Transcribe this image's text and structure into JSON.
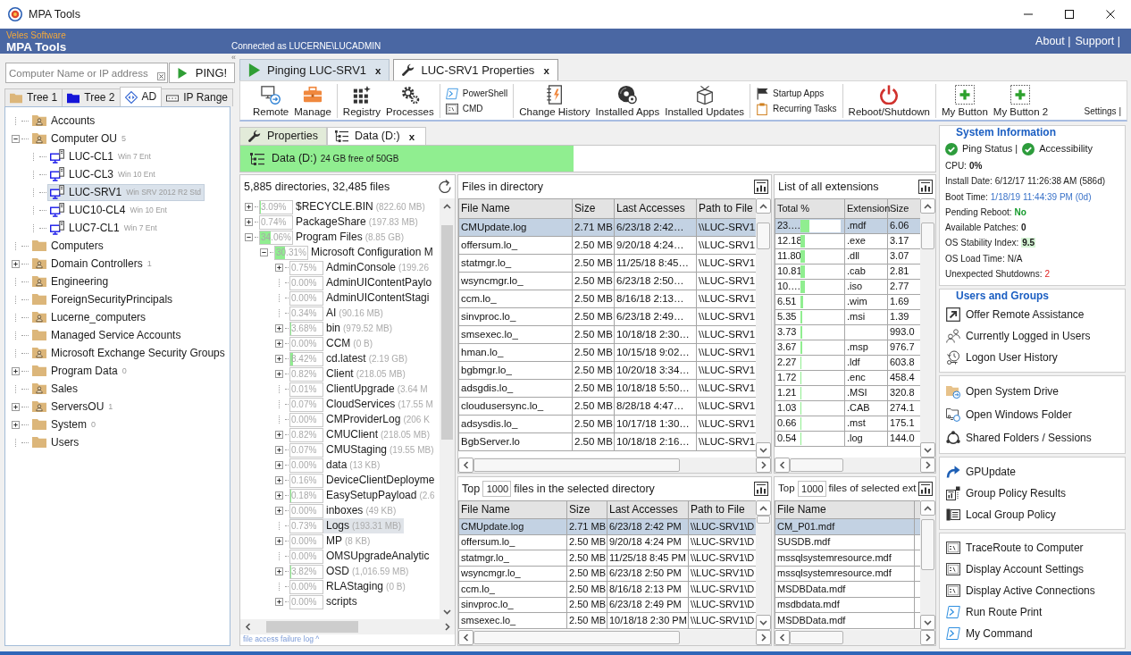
{
  "window": {
    "title": "MPA Tools"
  },
  "header": {
    "vendor": "Veles Software",
    "product": "MPA Tools",
    "connection": "Connected as LUCERNE\\LUCADMIN",
    "links": [
      "About |",
      "Support |"
    ]
  },
  "left_panel": {
    "collapse": "«",
    "ping": {
      "placeholder": "Computer Name or IP address",
      "button": "PING!"
    },
    "tabs": [
      {
        "label": "Tree 1",
        "selected": false
      },
      {
        "label": "Tree 2",
        "selected": false
      },
      {
        "label": "AD",
        "selected": true
      },
      {
        "label": "IP Range",
        "selected": false
      }
    ],
    "tree": [
      {
        "label": "Accounts",
        "kind": "ou",
        "expandable": false,
        "selected": false
      },
      {
        "label": "Computer OU",
        "kind": "ou",
        "count": "5",
        "expandable": true,
        "expanded": true,
        "selected": false,
        "children": [
          {
            "label": "LUC-CL1",
            "kind": "computer",
            "os": "Win 7 Ent",
            "expandable": false,
            "selected": false
          },
          {
            "label": "LUC-CL3",
            "kind": "computer",
            "os": "Win 10 Ent",
            "expandable": false,
            "selected": false
          },
          {
            "label": "LUC-SRV1",
            "kind": "computer",
            "os": "Win SRV 2012 R2 Std",
            "expandable": false,
            "selected": true
          },
          {
            "label": "LUC10-CL4",
            "kind": "computer",
            "os": "Win 10 Ent",
            "expandable": false,
            "selected": false
          },
          {
            "label": "LUC7-CL1",
            "kind": "computer",
            "os": "Win 7 Ent",
            "expandable": false,
            "selected": false
          }
        ]
      },
      {
        "label": "Computers",
        "kind": "folder",
        "expandable": false,
        "selected": false
      },
      {
        "label": "Domain Controllers",
        "kind": "ou",
        "count": "1",
        "expandable": true,
        "expanded": false,
        "selected": false
      },
      {
        "label": "Engineering",
        "kind": "ou",
        "expandable": false,
        "selected": false
      },
      {
        "label": "ForeignSecurityPrincipals",
        "kind": "folder",
        "expandable": false,
        "selected": false
      },
      {
        "label": "Lucerne_computers",
        "kind": "ou",
        "expandable": false,
        "selected": false
      },
      {
        "label": "Managed Service Accounts",
        "kind": "folder",
        "expandable": false,
        "selected": false
      },
      {
        "label": "Microsoft Exchange Security Groups",
        "kind": "ou",
        "expandable": false,
        "selected": false
      },
      {
        "label": "Program Data",
        "kind": "folder",
        "count": "0",
        "expandable": true,
        "expanded": false,
        "selected": false
      },
      {
        "label": "Sales",
        "kind": "ou",
        "expandable": false,
        "selected": false
      },
      {
        "label": "ServersOU",
        "kind": "ou",
        "count": "1",
        "expandable": true,
        "expanded": false,
        "selected": false
      },
      {
        "label": "System",
        "kind": "folder",
        "count": "0",
        "expandable": true,
        "expanded": false,
        "selected": false
      },
      {
        "label": "Users",
        "kind": "folder",
        "expandable": false,
        "selected": false
      }
    ]
  },
  "tabs": [
    {
      "label": "Pinging LUC-SRV1",
      "close": "x",
      "selected": false
    },
    {
      "label": "LUC-SRV1 Properties",
      "close": "x",
      "selected": true
    }
  ],
  "toolbar": {
    "groups": [
      {
        "items": [
          {
            "label": "Remote",
            "kind": "large"
          },
          {
            "label": "Manage",
            "kind": "large"
          }
        ]
      },
      {
        "items": [
          {
            "label": "Registry",
            "kind": "large"
          },
          {
            "label": "Processes",
            "kind": "large"
          }
        ]
      },
      {
        "items": [
          {
            "label": "PowerShell",
            "kind": "small"
          },
          {
            "label": "CMD",
            "kind": "small"
          }
        ]
      },
      {
        "items": [
          {
            "label": "Change History",
            "kind": "large"
          },
          {
            "label": "Installed Apps",
            "kind": "large"
          },
          {
            "label": "Installed Updates",
            "kind": "large"
          }
        ]
      },
      {
        "items": [
          {
            "label": "Startup Apps",
            "kind": "small"
          },
          {
            "label": "Recurring Tasks",
            "kind": "small"
          }
        ]
      },
      {
        "items": [
          {
            "label": "Reboot/Shutdown",
            "kind": "large"
          }
        ]
      },
      {
        "items": [
          {
            "label": "My Button",
            "kind": "large"
          },
          {
            "label": "My Button 2",
            "kind": "large"
          }
        ]
      }
    ],
    "settings": "Settings |"
  },
  "sub_tabs": [
    {
      "label": "Properties",
      "selected": false
    },
    {
      "label": "Data (D:)",
      "close": "x",
      "selected": true
    }
  ],
  "drive": {
    "label": "Data (D:)",
    "detail": "24 GB free of 50GB",
    "level": 0.48
  },
  "directory": {
    "summary": "5,885 directories, 32,485 files",
    "items": [
      {
        "name": "$RECYCLE.BIN",
        "size": "(822.60 MB)",
        "percent": "3.09%",
        "level": 0.04,
        "expandable": true,
        "expanded": false,
        "selected": false
      },
      {
        "name": "PackageShare",
        "size": "(197.83 MB)",
        "percent": "0.74%",
        "expandable": true,
        "expanded": false,
        "selected": false
      },
      {
        "name": "Program Files",
        "size": "(8.85 GB)",
        "percent": "34.06%",
        "level": 0.34,
        "expandable": true,
        "expanded": true,
        "selected": false,
        "children": [
          {
            "name": "Microsoft Configuration M",
            "percent": "30.31%",
            "level": 0.3,
            "expandable": true,
            "expanded": true,
            "selected": false,
            "children": [
              {
                "name": "AdminConsole",
                "size": "(199.26",
                "percent": "0.75%",
                "expandable": true,
                "expanded": false,
                "selected": false
              },
              {
                "name": "AdminUIContentPaylo",
                "percent": "0.00%",
                "expandable": false,
                "selected": false
              },
              {
                "name": "AdminUIContentStagi",
                "percent": "0.00%",
                "expandable": false,
                "selected": false
              },
              {
                "name": "AI",
                "size": "(90.16 MB)",
                "percent": "0.34%",
                "expandable": false,
                "selected": false
              },
              {
                "name": "bin",
                "size": "(979.52 MB)",
                "percent": "3.68%",
                "level": 0.04,
                "expandable": true,
                "expanded": false,
                "selected": false
              },
              {
                "name": "CCM",
                "size": "(0 B)",
                "percent": "0.00%",
                "expandable": true,
                "expanded": false,
                "selected": false
              },
              {
                "name": "cd.latest",
                "size": "(2.19 GB)",
                "percent": "8.42%",
                "level": 0.08,
                "expandable": true,
                "expanded": false,
                "selected": false
              },
              {
                "name": "Client",
                "size": "(218.05 MB)",
                "percent": "0.82%",
                "expandable": true,
                "expanded": false,
                "selected": false
              },
              {
                "name": "ClientUpgrade",
                "size": "(3.64 M",
                "percent": "0.01%",
                "expandable": false,
                "selected": false
              },
              {
                "name": "CloudServices",
                "size": "(17.55 M",
                "percent": "0.07%",
                "expandable": false,
                "selected": false
              },
              {
                "name": "CMProviderLog",
                "size": "(206 K",
                "percent": "0.00%",
                "expandable": false,
                "selected": false
              },
              {
                "name": "CMUClient",
                "size": "(218.05 MB)",
                "percent": "0.82%",
                "expandable": true,
                "expanded": false,
                "selected": false
              },
              {
                "name": "CMUStaging",
                "size": "(19.55 MB)",
                "percent": "0.07%",
                "expandable": true,
                "expanded": false,
                "selected": false
              },
              {
                "name": "data",
                "size": "(13 KB)",
                "percent": "0.00%",
                "expandable": true,
                "expanded": false,
                "selected": false
              },
              {
                "name": "DeviceClientDeployme",
                "percent": "0.16%",
                "expandable": true,
                "expanded": false,
                "selected": false
              },
              {
                "name": "EasySetupPayload",
                "size": "(2.6",
                "percent": "0.18%",
                "level": 0.03,
                "expandable": true,
                "expanded": false,
                "selected": false
              },
              {
                "name": "inboxes",
                "size": "(49 KB)",
                "percent": "0.00%",
                "expandable": true,
                "expanded": false,
                "selected": false
              },
              {
                "name": "Logs",
                "size": "(193.31 MB)",
                "percent": "0.73%",
                "expandable": false,
                "selected": true
              },
              {
                "name": "MP",
                "size": "(8 KB)",
                "percent": "0.00%",
                "expandable": true,
                "expanded": false,
                "selected": false
              },
              {
                "name": "OMSUpgradeAnalytic",
                "percent": "0.00%",
                "expandable": false,
                "selected": false
              },
              {
                "name": "OSD",
                "size": "(1,016.59 MB)",
                "percent": "3.82%",
                "level": 0.04,
                "expandable": true,
                "expanded": false,
                "selected": false
              },
              {
                "name": "RLAStaging",
                "size": "(0 B)",
                "percent": "0.00%",
                "expandable": false,
                "selected": false
              },
              {
                "name": "scripts",
                "percent": "0.00%",
                "expandable": true,
                "expanded": false,
                "selected": false
              }
            ]
          }
        ]
      }
    ],
    "footer": "file access failure log ^"
  },
  "files": {
    "title": "Files in directory",
    "columns": [
      "File Name",
      "Size",
      "Last Accesses",
      "Path to File"
    ],
    "rows": [
      {
        "cells": [
          "CMUpdate.log",
          "2.71 MB",
          "6/23/18 2:42…",
          "\\\\LUC-SRV1"
        ],
        "selected": true
      },
      {
        "cells": [
          "offersum.lo_",
          "2.50 MB",
          "9/20/18 4:24…",
          "\\\\LUC-SRV1"
        ],
        "selected": false
      },
      {
        "cells": [
          "statmgr.lo_",
          "2.50 MB",
          "11/25/18 8:45…",
          "\\\\LUC-SRV1"
        ],
        "selected": false
      },
      {
        "cells": [
          "wsyncmgr.lo_",
          "2.50 MB",
          "6/23/18 2:50…",
          "\\\\LUC-SRV1"
        ],
        "selected": false
      },
      {
        "cells": [
          "ccm.lo_",
          "2.50 MB",
          "8/16/18 2:13…",
          "\\\\LUC-SRV1"
        ],
        "selected": false
      },
      {
        "cells": [
          "sinvproc.lo_",
          "2.50 MB",
          "6/23/18 2:49…",
          "\\\\LUC-SRV1"
        ],
        "selected": false
      },
      {
        "cells": [
          "smsexec.lo_",
          "2.50 MB",
          "10/18/18 2:30…",
          "\\\\LUC-SRV1"
        ],
        "selected": false
      },
      {
        "cells": [
          "hman.lo_",
          "2.50 MB",
          "10/15/18 9:02…",
          "\\\\LUC-SRV1"
        ],
        "selected": false
      },
      {
        "cells": [
          "bgbmgr.lo_",
          "2.50 MB",
          "10/20/18 3:34…",
          "\\\\LUC-SRV1"
        ],
        "selected": false
      },
      {
        "cells": [
          "adsgdis.lo_",
          "2.50 MB",
          "10/18/18 5:50…",
          "\\\\LUC-SRV1"
        ],
        "selected": false
      },
      {
        "cells": [
          "cloudusersync.lo_",
          "2.50 MB",
          "8/28/18 4:47…",
          "\\\\LUC-SRV1"
        ],
        "selected": false
      },
      {
        "cells": [
          "adsysdis.lo_",
          "2.50 MB",
          "10/17/18 1:30…",
          "\\\\LUC-SRV1"
        ],
        "selected": false
      },
      {
        "cells": [
          "BgbServer.lo",
          "2.50 MB",
          "10/18/18 2:16…",
          "\\\\LUC-SRV1"
        ],
        "selected": false
      }
    ]
  },
  "extensions": {
    "title": "List of all extensions",
    "columns": [
      "Total %",
      "Extension",
      "Size"
    ],
    "rows": [
      {
        "percent": "23.…",
        "level": 0.23,
        "extension": ".mdf",
        "size": "6.06",
        "selected": true
      },
      {
        "percent": "12.18",
        "level": 0.12,
        "extension": ".exe",
        "size": "3.17",
        "selected": false
      },
      {
        "percent": "11.80",
        "level": 0.118,
        "extension": ".dll",
        "size": "3.07",
        "selected": false
      },
      {
        "percent": "10.81",
        "level": 0.108,
        "extension": ".cab",
        "size": "2.81",
        "selected": false
      },
      {
        "percent": "10.…",
        "level": 0.105,
        "extension": ".iso",
        "size": "2.77",
        "selected": false
      },
      {
        "percent": "6.51",
        "level": 0.065,
        "extension": ".wim",
        "size": "1.69",
        "selected": false
      },
      {
        "percent": "5.35",
        "level": 0.054,
        "extension": ".msi",
        "size": "1.39",
        "selected": false
      },
      {
        "percent": "3.73",
        "level": 0.037,
        "size": "993.0",
        "selected": false
      },
      {
        "percent": "3.67",
        "level": 0.037,
        "extension": ".msp",
        "size": "976.7",
        "selected": false
      },
      {
        "percent": "2.27",
        "level": 0.023,
        "extension": ".ldf",
        "size": "603.8",
        "selected": false
      },
      {
        "percent": "1.72",
        "level": 0.017,
        "extension": ".enc",
        "size": "458.4",
        "selected": false
      },
      {
        "percent": "1.21",
        "level": 0.012,
        "extension": ".MSI",
        "size": "320.8",
        "selected": false
      },
      {
        "percent": "1.03",
        "level": 0.01,
        "extension": ".CAB",
        "size": "274.1",
        "selected": false
      },
      {
        "percent": "0.66",
        "level": 0.007,
        "extension": ".mst",
        "size": "175.1",
        "selected": false
      },
      {
        "percent": "0.54",
        "level": 0.005,
        "extension": ".log",
        "size": "144.0",
        "selected": false
      }
    ]
  },
  "top_files": {
    "prefix": "Top",
    "count": "1000",
    "suffix": "files in the selected directory",
    "columns": [
      "File Name",
      "Size",
      "Last Accesses",
      "Path to File"
    ],
    "rows": [
      {
        "cells": [
          "CMUpdate.log",
          "2.71 MB",
          "6/23/18 2:42 PM",
          "\\\\LUC-SRV1\\D"
        ],
        "selected": true
      },
      {
        "cells": [
          "offersum.lo_",
          "2.50 MB",
          "9/20/18 4:24 PM",
          "\\\\LUC-SRV1\\D"
        ],
        "selected": false
      },
      {
        "cells": [
          "statmgr.lo_",
          "2.50 MB",
          "11/25/18 8:45 PM",
          "\\\\LUC-SRV1\\D"
        ],
        "selected": false
      },
      {
        "cells": [
          "wsyncmgr.lo_",
          "2.50 MB",
          "6/23/18 2:50 PM",
          "\\\\LUC-SRV1\\D"
        ],
        "selected": false
      },
      {
        "cells": [
          "ccm.lo_",
          "2.50 MB",
          "8/16/18 2:13 PM",
          "\\\\LUC-SRV1\\D"
        ],
        "selected": false
      },
      {
        "cells": [
          "sinvproc.lo_",
          "2.50 MB",
          "6/23/18 2:49 PM",
          "\\\\LUC-SRV1\\D"
        ],
        "selected": false
      },
      {
        "cells": [
          "smsexec.lo_",
          "2.50 MB",
          "10/18/18 2:30 PM",
          "\\\\LUC-SRV1\\D"
        ],
        "selected": false
      }
    ]
  },
  "top_ext_files": {
    "prefix": "Top",
    "count": "1000",
    "suffix": "files of selected ext",
    "columns": [
      "File Name"
    ],
    "rows": [
      {
        "cells": [
          "CM_P01.mdf"
        ],
        "selected": true
      },
      {
        "cells": [
          "SUSDB.mdf"
        ],
        "selected": false
      },
      {
        "cells": [
          "mssqlsystemresource.mdf"
        ],
        "selected": false
      },
      {
        "cells": [
          "mssqlsystemresource.mdf"
        ],
        "selected": false
      },
      {
        "cells": [
          "MSDBData.mdf"
        ],
        "selected": false
      },
      {
        "cells": [
          "msdbdata.mdf"
        ],
        "selected": false
      },
      {
        "cells": [
          "MSDBData.mdf"
        ],
        "selected": false
      }
    ]
  },
  "system_info": {
    "title": "System Information",
    "status": [
      {
        "label": "Ping Status |",
        "ok": true
      },
      {
        "label": "Accessibility",
        "ok": true
      }
    ],
    "rows": [
      {
        "label": "CPU:",
        "value": "0%",
        "kind": "bold"
      },
      {
        "label": "Install Date:",
        "value": "6/12/17 11:26:38 AM (586d)",
        "kind": "plain"
      },
      {
        "label": "Boot Time:",
        "value": "1/18/19 11:44:39 PM (0d)",
        "kind": "link"
      },
      {
        "label": "Pending Reboot:",
        "value": "No",
        "kind": "good"
      },
      {
        "label": "Available Patches:",
        "value": "0",
        "kind": "bold"
      },
      {
        "label": "OS Stability Index:",
        "value": "9.5",
        "kind": "highlight"
      },
      {
        "label": "OS Load Time:",
        "value": "N/A",
        "kind": "plain"
      },
      {
        "label": "Unexpected Shutdowns:",
        "value": "2",
        "kind": "alert"
      }
    ]
  },
  "action_groups": [
    {
      "title": "Users and Groups",
      "items": [
        "Offer Remote Assistance",
        "Currently Logged in Users",
        "Logon User History"
      ]
    },
    {
      "items": [
        "Open System Drive",
        "Open Windows Folder",
        "Shared Folders / Sessions"
      ]
    },
    {
      "items": [
        "GPUpdate",
        "Group Policy Results",
        "Local Group Policy"
      ]
    },
    {
      "items": [
        "TraceRoute to Computer",
        "Display Account Settings",
        "Display Active Connections",
        "Run Route Print",
        "My Command"
      ]
    }
  ]
}
